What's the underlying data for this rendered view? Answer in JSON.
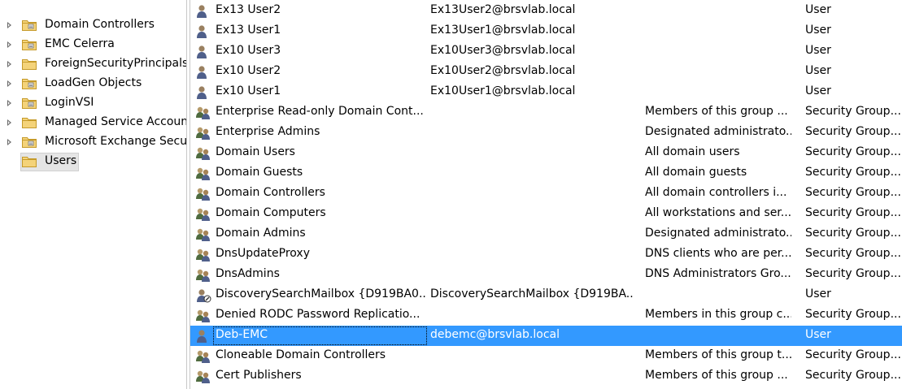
{
  "tree": {
    "items": [
      {
        "label": "Domain Controllers",
        "expander": true,
        "folder": "ou"
      },
      {
        "label": "EMC Celerra",
        "expander": true,
        "folder": "ou"
      },
      {
        "label": "ForeignSecurityPrincipals",
        "expander": true,
        "folder": "plain"
      },
      {
        "label": "LoadGen Objects",
        "expander": true,
        "folder": "ou"
      },
      {
        "label": "LoginVSI",
        "expander": true,
        "folder": "ou"
      },
      {
        "label": "Managed Service Accounts",
        "expander": true,
        "folder": "plain"
      },
      {
        "label": "Microsoft Exchange Security Groups",
        "expander": true,
        "folder": "ou"
      },
      {
        "label": "Users",
        "expander": false,
        "folder": "plain",
        "selected": true
      }
    ]
  },
  "list": {
    "rows": [
      {
        "name": "Ex13 User2",
        "upn": "Ex13User2@brsvlab.local",
        "description": "",
        "type": "User",
        "icon": "user-icon"
      },
      {
        "name": "Ex13 User1",
        "upn": "Ex13User1@brsvlab.local",
        "description": "",
        "type": "User",
        "icon": "user-icon"
      },
      {
        "name": "Ex10 User3",
        "upn": "Ex10User3@brsvlab.local",
        "description": "",
        "type": "User",
        "icon": "user-icon"
      },
      {
        "name": "Ex10 User2",
        "upn": "Ex10User2@brsvlab.local",
        "description": "",
        "type": "User",
        "icon": "user-icon"
      },
      {
        "name": "Ex10 User1",
        "upn": "Ex10User1@brsvlab.local",
        "description": "",
        "type": "User",
        "icon": "user-icon"
      },
      {
        "name": "Enterprise Read-only Domain Cont...",
        "upn": "",
        "description": "Members of this group ...",
        "type": "Security Group...",
        "icon": "group-icon"
      },
      {
        "name": "Enterprise Admins",
        "upn": "",
        "description": "Designated administrato...",
        "type": "Security Group...",
        "icon": "group-icon"
      },
      {
        "name": "Domain Users",
        "upn": "",
        "description": "All domain users",
        "type": "Security Group...",
        "icon": "group-icon"
      },
      {
        "name": "Domain Guests",
        "upn": "",
        "description": "All domain guests",
        "type": "Security Group...",
        "icon": "group-icon"
      },
      {
        "name": "Domain Controllers",
        "upn": "",
        "description": "All domain controllers i...",
        "type": "Security Group...",
        "icon": "group-icon"
      },
      {
        "name": "Domain Computers",
        "upn": "",
        "description": "All workstations and ser...",
        "type": "Security Group...",
        "icon": "group-icon"
      },
      {
        "name": "Domain Admins",
        "upn": "",
        "description": "Designated administrato...",
        "type": "Security Group...",
        "icon": "group-icon"
      },
      {
        "name": "DnsUpdateProxy",
        "upn": "",
        "description": "DNS clients who are per...",
        "type": "Security Group...",
        "icon": "group-icon"
      },
      {
        "name": "DnsAdmins",
        "upn": "",
        "description": "DNS Administrators Gro...",
        "type": "Security Group...",
        "icon": "group-icon"
      },
      {
        "name": "DiscoverySearchMailbox {D919BA0...",
        "upn": "DiscoverySearchMailbox {D919BA...",
        "description": "",
        "type": "User",
        "icon": "disabled-user-icon"
      },
      {
        "name": "Denied RODC Password Replicatio...",
        "upn": "",
        "description": "Members in this group c...",
        "type": "Security Group...",
        "icon": "group-icon"
      },
      {
        "name": "Deb-EMC",
        "upn": "debemc@brsvlab.local",
        "description": "",
        "type": "User",
        "icon": "user-icon",
        "selected": true
      },
      {
        "name": "Cloneable Domain Controllers",
        "upn": "",
        "description": "Members of this group t...",
        "type": "Security Group...",
        "icon": "group-icon"
      },
      {
        "name": "Cert Publishers",
        "upn": "",
        "description": "Members of this group ...",
        "type": "Security Group...",
        "icon": "group-icon"
      }
    ]
  },
  "colors": {
    "selection": "#3399ff",
    "tree_selection": "#e5e5e5",
    "folder_yellow": "#e8c25a"
  }
}
